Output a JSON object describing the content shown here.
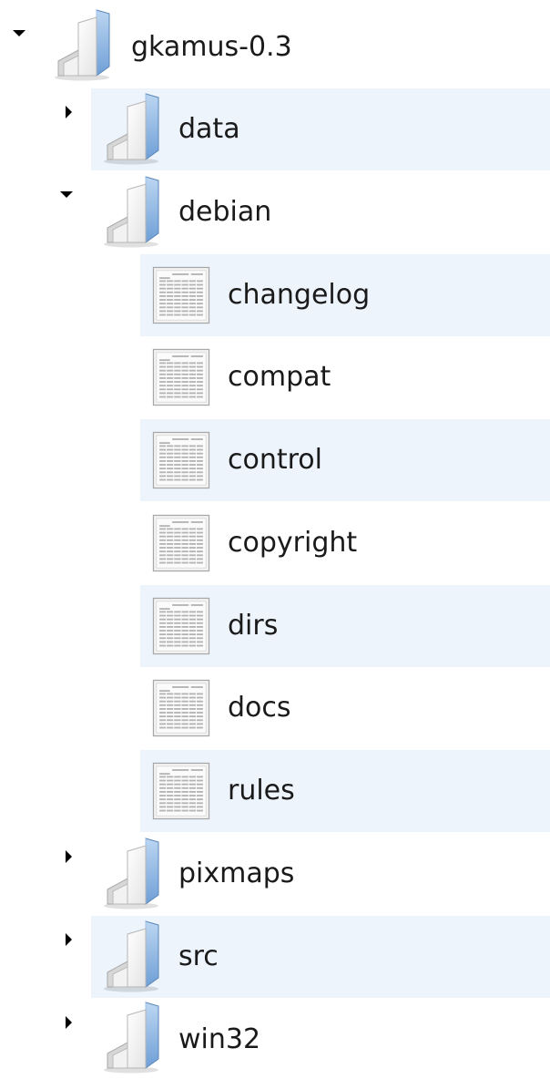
{
  "tree": {
    "root": {
      "label": "gkamus-0.3",
      "icon": "folder-icon",
      "state": "expanded",
      "children": [
        {
          "label": "data",
          "icon": "folder-icon",
          "state": "collapsed"
        },
        {
          "label": "debian",
          "icon": "folder-icon",
          "state": "expanded",
          "children": [
            {
              "label": "changelog",
              "icon": "text-file-icon"
            },
            {
              "label": "compat",
              "icon": "text-file-icon"
            },
            {
              "label": "control",
              "icon": "text-file-icon"
            },
            {
              "label": "copyright",
              "icon": "text-file-icon"
            },
            {
              "label": "dirs",
              "icon": "text-file-icon"
            },
            {
              "label": "docs",
              "icon": "text-file-icon"
            },
            {
              "label": "rules",
              "icon": "text-file-icon"
            }
          ]
        },
        {
          "label": "pixmaps",
          "icon": "folder-icon",
          "state": "collapsed"
        },
        {
          "label": "src",
          "icon": "folder-icon",
          "state": "collapsed"
        },
        {
          "label": "win32",
          "icon": "folder-icon",
          "state": "collapsed"
        }
      ]
    }
  },
  "colors": {
    "stripe": "#edf4fc",
    "text": "#1a1a1a",
    "folder_blue": "#7ea9d9"
  }
}
